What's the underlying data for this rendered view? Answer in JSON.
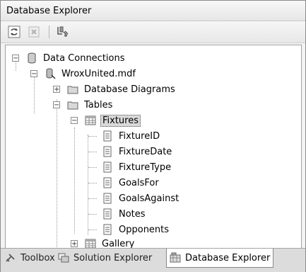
{
  "window": {
    "title": "Database Explorer"
  },
  "toolbar": {
    "buttons": [
      {
        "name": "refresh-button",
        "icon": "refresh-icon"
      },
      {
        "name": "stop-refresh-button",
        "icon": "stop-icon"
      },
      {
        "name": "connect-to-database-button",
        "icon": "connect-icon"
      }
    ]
  },
  "tree": {
    "data_connections": "Data Connections",
    "database": "WroxUnited.mdf",
    "database_diagrams": "Database Diagrams",
    "tables": "Tables",
    "fixtures": "Fixtures",
    "columns": [
      "FixtureID",
      "FixtureDate",
      "FixtureType",
      "GoalsFor",
      "GoalsAgainst",
      "Notes",
      "Opponents"
    ],
    "gallery": "Gallery"
  },
  "tabs": {
    "toolbox": "Toolbox",
    "solution_explorer": "Solution Explorer",
    "database_explorer": "Database Explorer"
  }
}
